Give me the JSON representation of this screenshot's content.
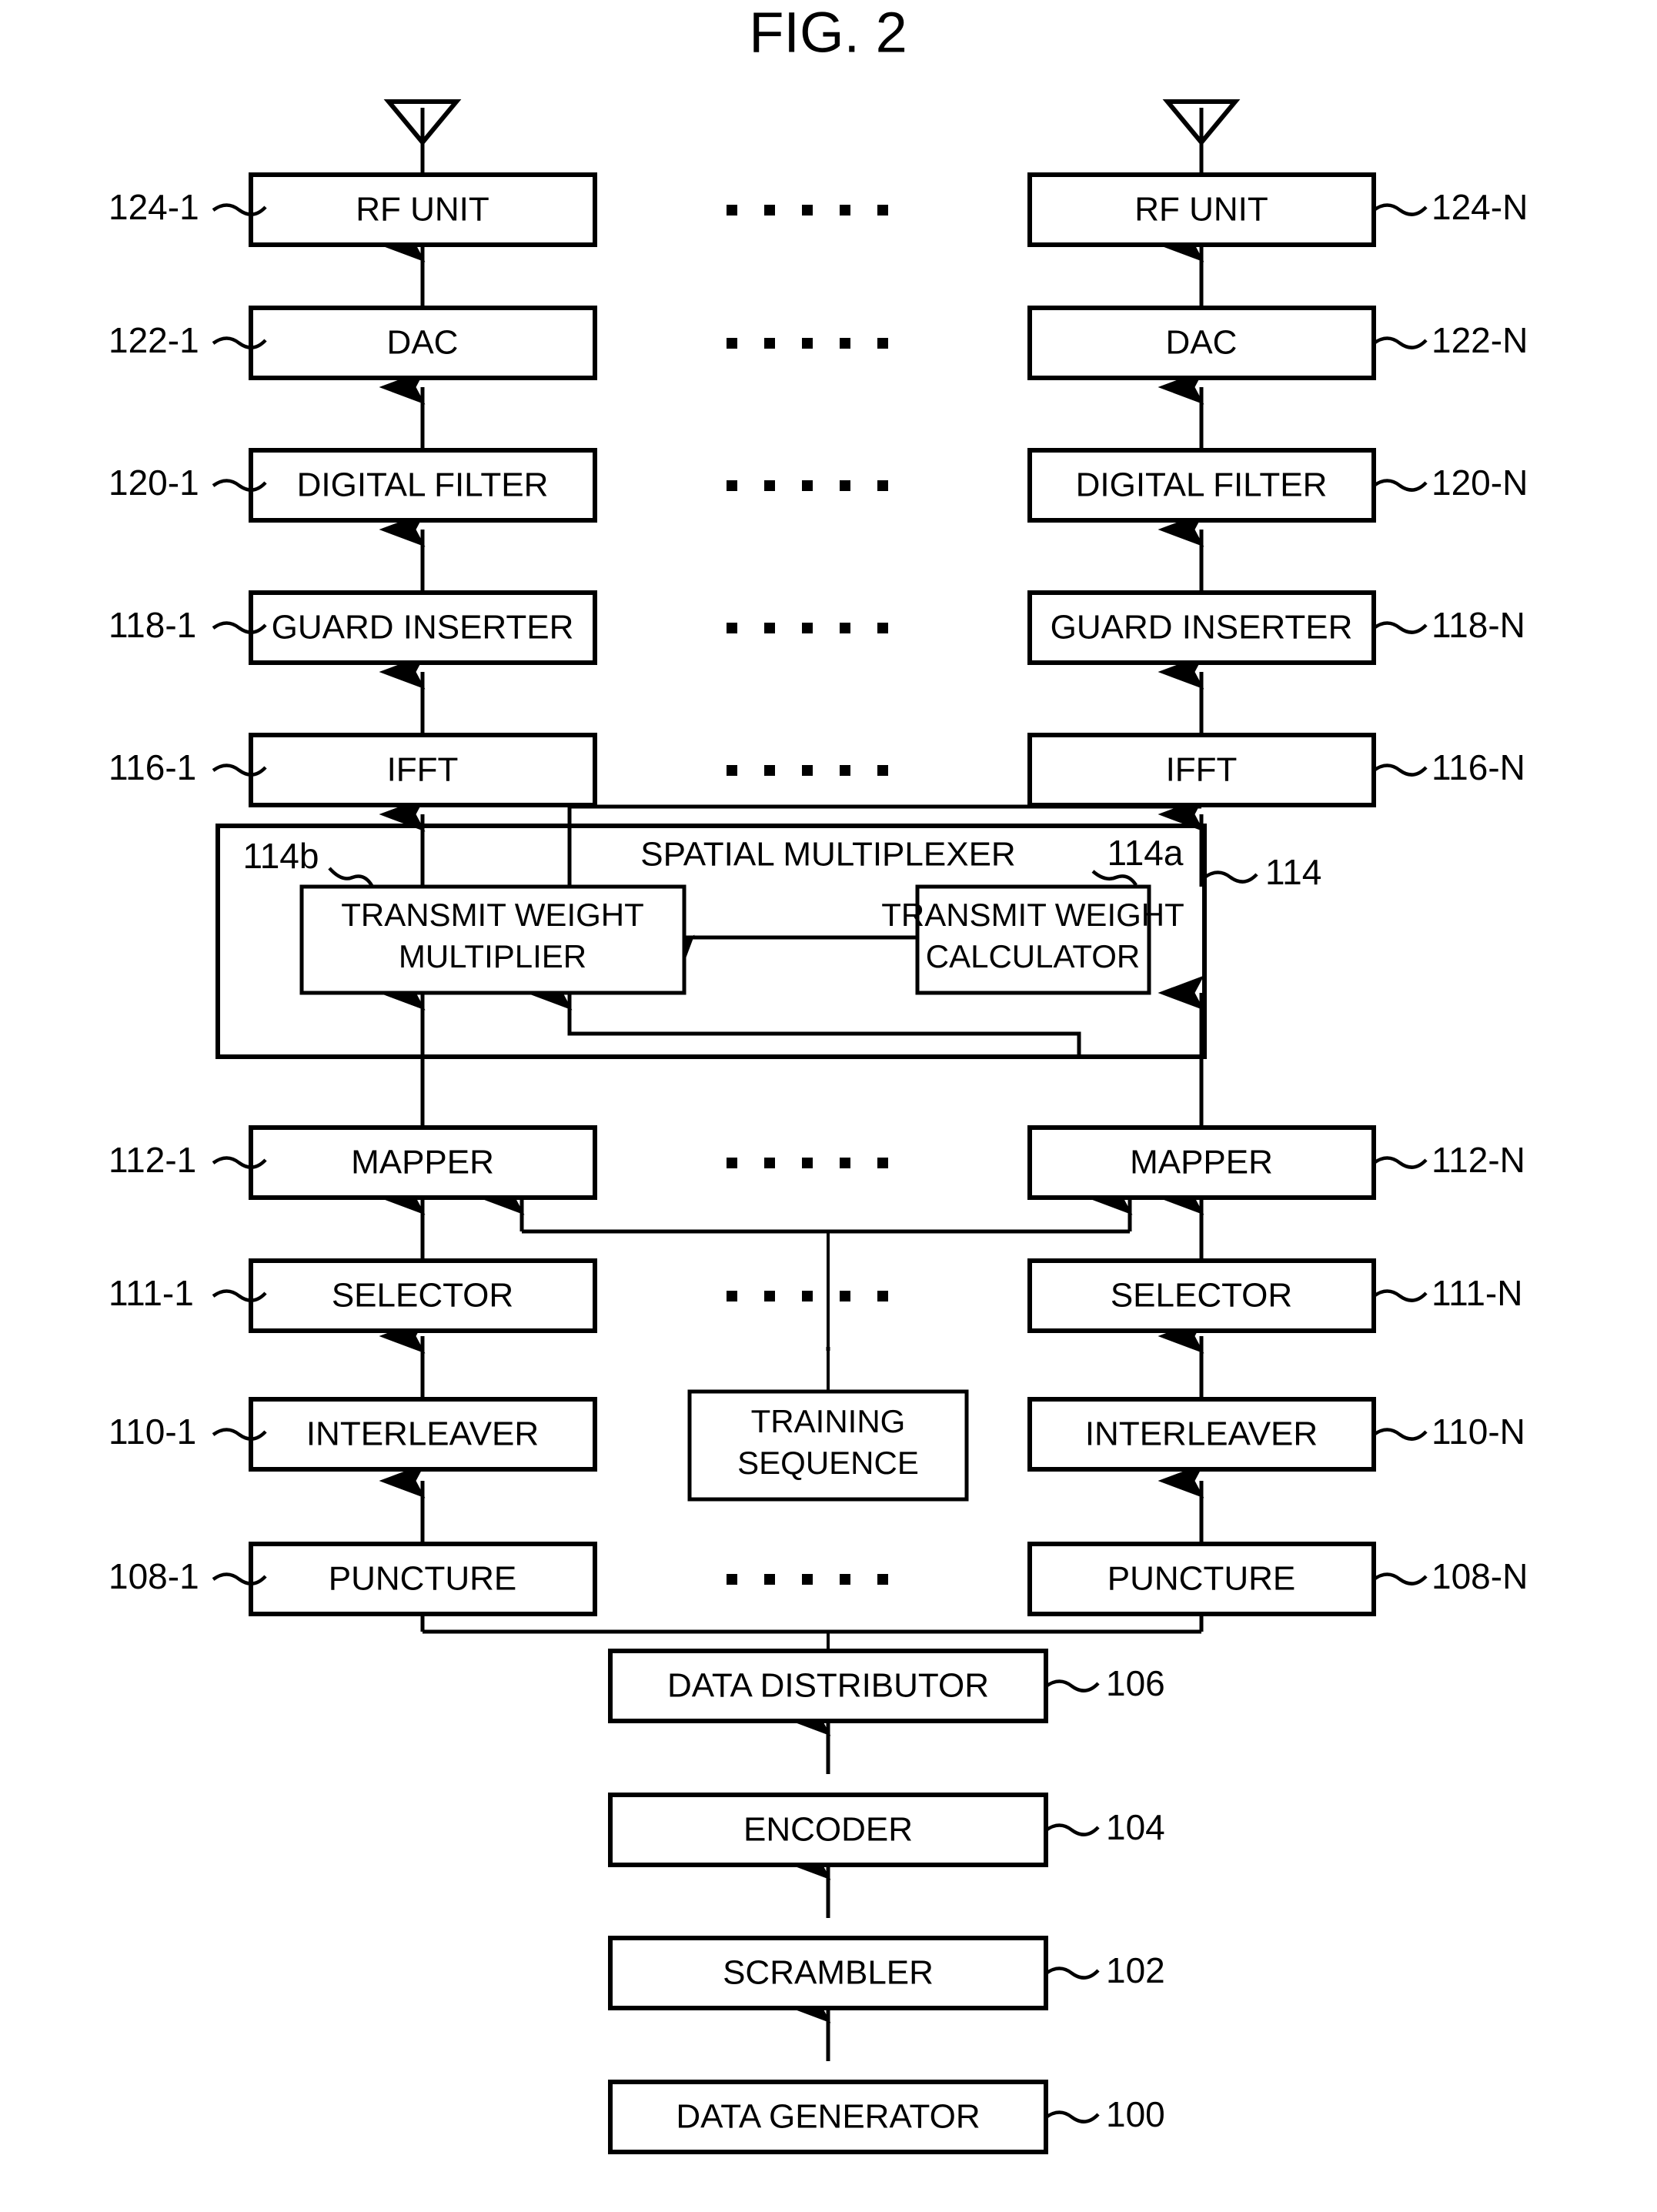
{
  "figure": {
    "title": "FIG. 2"
  },
  "ellipsis": {
    "glyph": "· · · · ·"
  },
  "chain_left": [
    {
      "label": "RF UNIT",
      "ref": "124-1"
    },
    {
      "label": "DAC",
      "ref": "122-1"
    },
    {
      "label": "DIGITAL FILTER",
      "ref": "120-1"
    },
    {
      "label": "GUARD INSERTER",
      "ref": "118-1"
    },
    {
      "label": "IFFT",
      "ref": "116-1"
    },
    {
      "label": "MAPPER",
      "ref": "112-1"
    },
    {
      "label": "SELECTOR",
      "ref": "111-1"
    },
    {
      "label": "INTERLEAVER",
      "ref": "110-1"
    },
    {
      "label": "PUNCTURE",
      "ref": "108-1"
    }
  ],
  "chain_right": [
    {
      "label": "RF UNIT",
      "ref": "124-N"
    },
    {
      "label": "DAC",
      "ref": "122-N"
    },
    {
      "label": "DIGITAL FILTER",
      "ref": "120-N"
    },
    {
      "label": "GUARD INSERTER",
      "ref": "118-N"
    },
    {
      "label": "IFFT",
      "ref": "116-N"
    },
    {
      "label": "MAPPER",
      "ref": "112-N"
    },
    {
      "label": "SELECTOR",
      "ref": "111-N"
    },
    {
      "label": "INTERLEAVER",
      "ref": "110-N"
    },
    {
      "label": "PUNCTURE",
      "ref": "108-N"
    }
  ],
  "spatial_multiplexer": {
    "title": "SPATIAL MULTIPLEXER",
    "ref": "114",
    "multiplier": {
      "line1": "TRANSMIT WEIGHT",
      "line2": "MULTIPLIER",
      "ref": "114b"
    },
    "calculator": {
      "line1": "TRANSMIT WEIGHT",
      "line2": "CALCULATOR",
      "ref": "114a"
    }
  },
  "training_sequence": {
    "line1": "TRAINING",
    "line2": "SEQUENCE"
  },
  "chain_bottom": [
    {
      "label": "DATA DISTRIBUTOR",
      "ref": "106"
    },
    {
      "label": "ENCODER",
      "ref": "104"
    },
    {
      "label": "SCRAMBLER",
      "ref": "102"
    },
    {
      "label": "DATA GENERATOR",
      "ref": "100"
    }
  ],
  "icons": {
    "antenna_left": "antenna-icon",
    "antenna_right": "antenna-icon"
  }
}
